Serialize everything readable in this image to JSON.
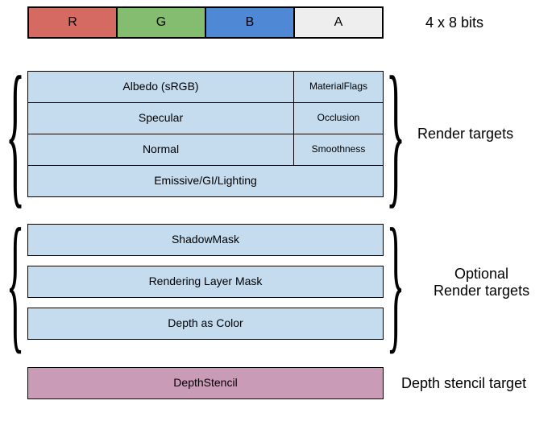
{
  "channels": {
    "r": {
      "label": "R",
      "color": "#d46a62"
    },
    "g": {
      "label": "G",
      "color": "#84bd70"
    },
    "b": {
      "label": "B",
      "color": "#4f89d5"
    },
    "a": {
      "label": "A",
      "color": "#eeeeee"
    }
  },
  "header_label": "4 x 8 bits",
  "render_targets": {
    "label": "Render targets",
    "rows": [
      {
        "rgb": "Albedo (sRGB)",
        "a": "MaterialFlags"
      },
      {
        "rgb": "Specular",
        "a": "Occlusion"
      },
      {
        "rgb": "Normal",
        "a": "Smoothness"
      },
      {
        "full": "Emissive/GI/Lighting"
      }
    ]
  },
  "optional_targets": {
    "label": "Optional\nRender targets",
    "rows": [
      {
        "full": "ShadowMask"
      },
      {
        "full": "Rendering Layer Mask"
      },
      {
        "full": "Depth as Color"
      }
    ]
  },
  "depth_stencil": {
    "label": "Depth stencil target",
    "row": "DepthStencil"
  },
  "colors": {
    "render_target_bg": "#c5dcef",
    "depth_stencil_bg": "#c99bb7"
  }
}
